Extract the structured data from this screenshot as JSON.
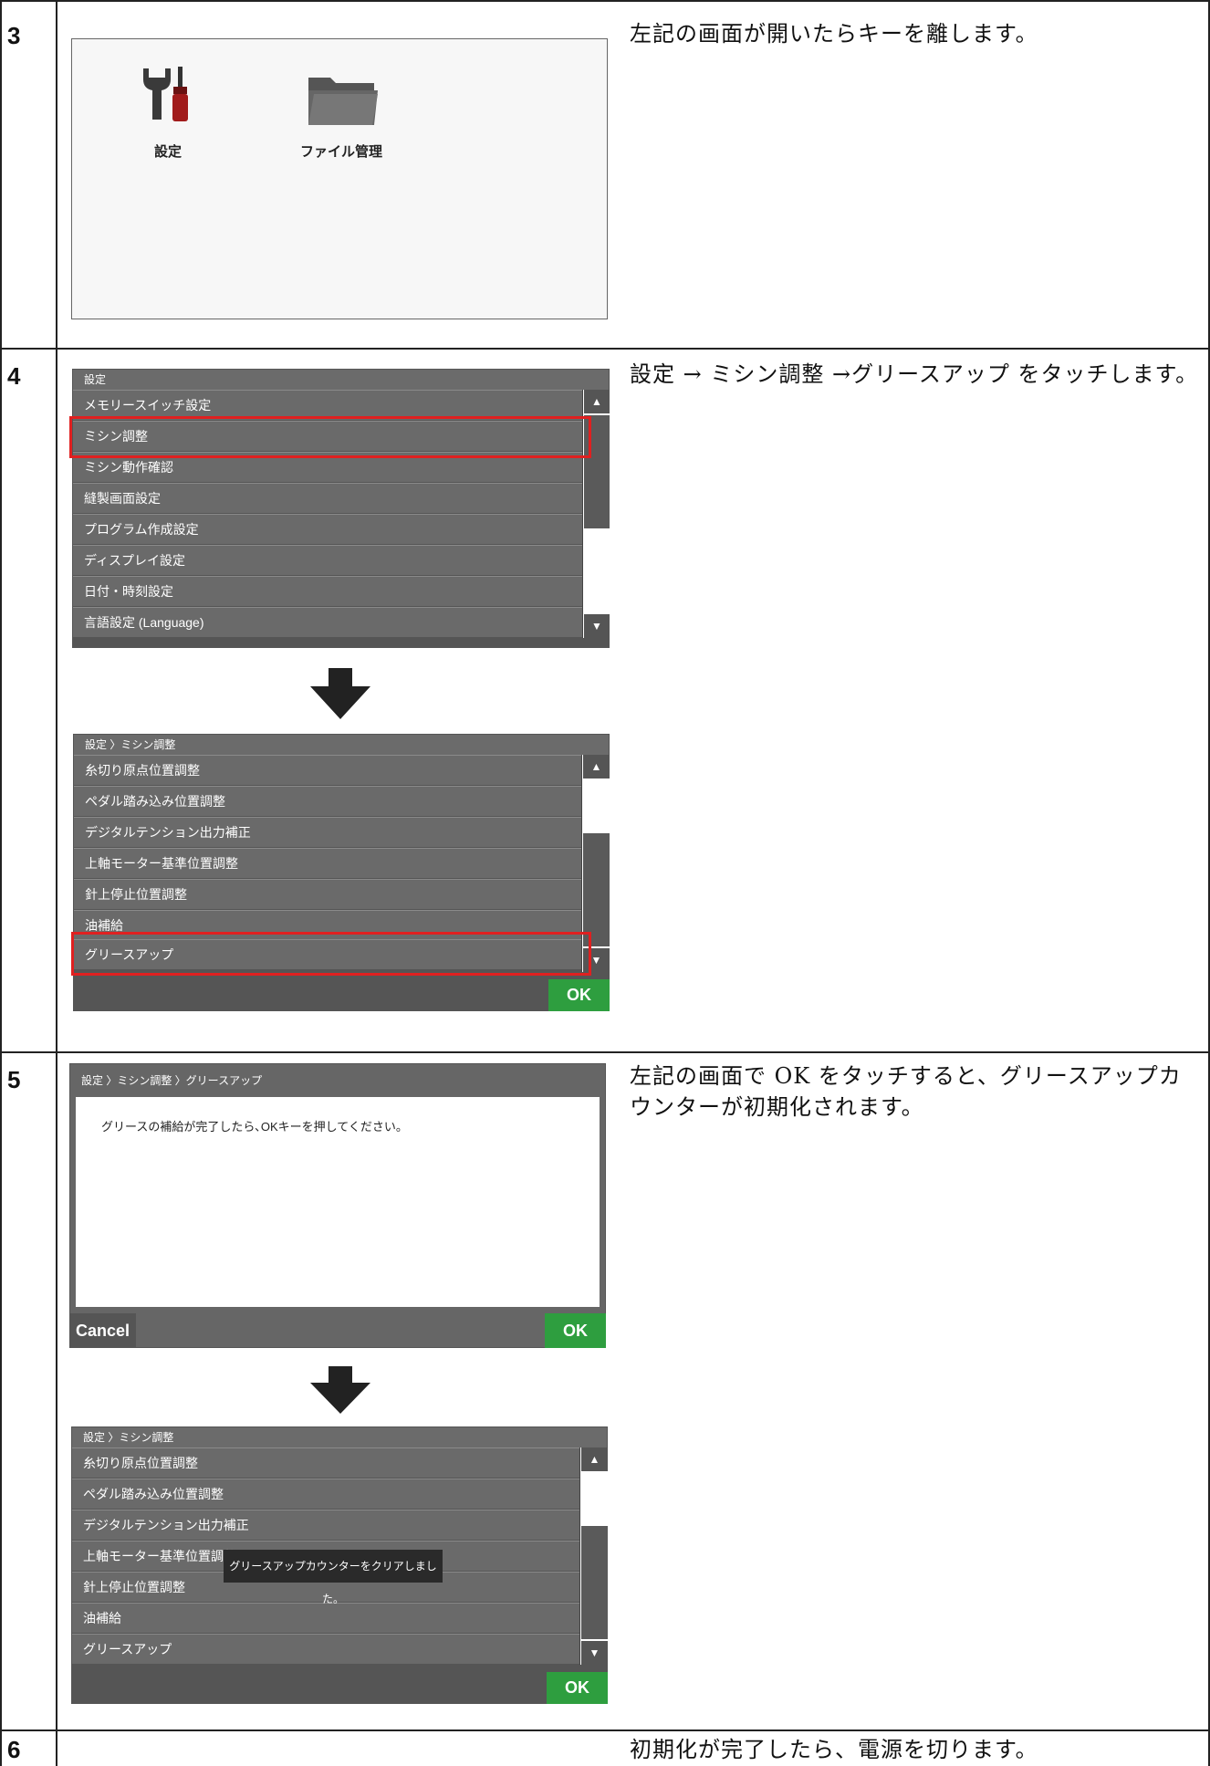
{
  "steps": [
    {
      "num": "3",
      "desc": "左記の画面が開いたらキーを離します。"
    },
    {
      "num": "4",
      "desc": "設定 → ミシン調整 →グリースアップ をタッチします。"
    },
    {
      "num": "5",
      "desc": "左記の画面で OK をタッチすると、グリースアップカウンターが初期化されます。"
    },
    {
      "num": "6",
      "desc": "初期化が完了したら、電源を切ります。"
    }
  ],
  "home": {
    "settings_label": "設定",
    "file_label": "ファイル管理"
  },
  "settings_list": {
    "header": "設定",
    "items": [
      "メモリースイッチ設定",
      "ミシン調整",
      "ミシン動作確認",
      "縫製画面設定",
      "プログラム作成設定",
      "ディスプレイ設定",
      "日付・時刻設定",
      "言語設定 (Language)"
    ]
  },
  "adjust_list": {
    "header": "設定 〉ミシン調整",
    "items": [
      "糸切り原点位置調整",
      "ペダル踏み込み位置調整",
      "デジタルテンション出力補正",
      "上軸モーター基準位置調整",
      "針上停止位置調整",
      "油補給",
      "グリースアップ"
    ],
    "ok": "OK"
  },
  "grease_dialog": {
    "header": "設定 〉ミシン調整 〉グリースアップ",
    "message": "グリースの補給が完了したら､OKキーを押してください。",
    "cancel": "Cancel",
    "ok": "OK"
  },
  "adjust_list2": {
    "header": "設定 〉ミシン調整",
    "toast": "グリースアップカウンターをクリアしました。",
    "ok": "OK"
  },
  "scroll": {
    "up": "▲",
    "down": "▼"
  }
}
